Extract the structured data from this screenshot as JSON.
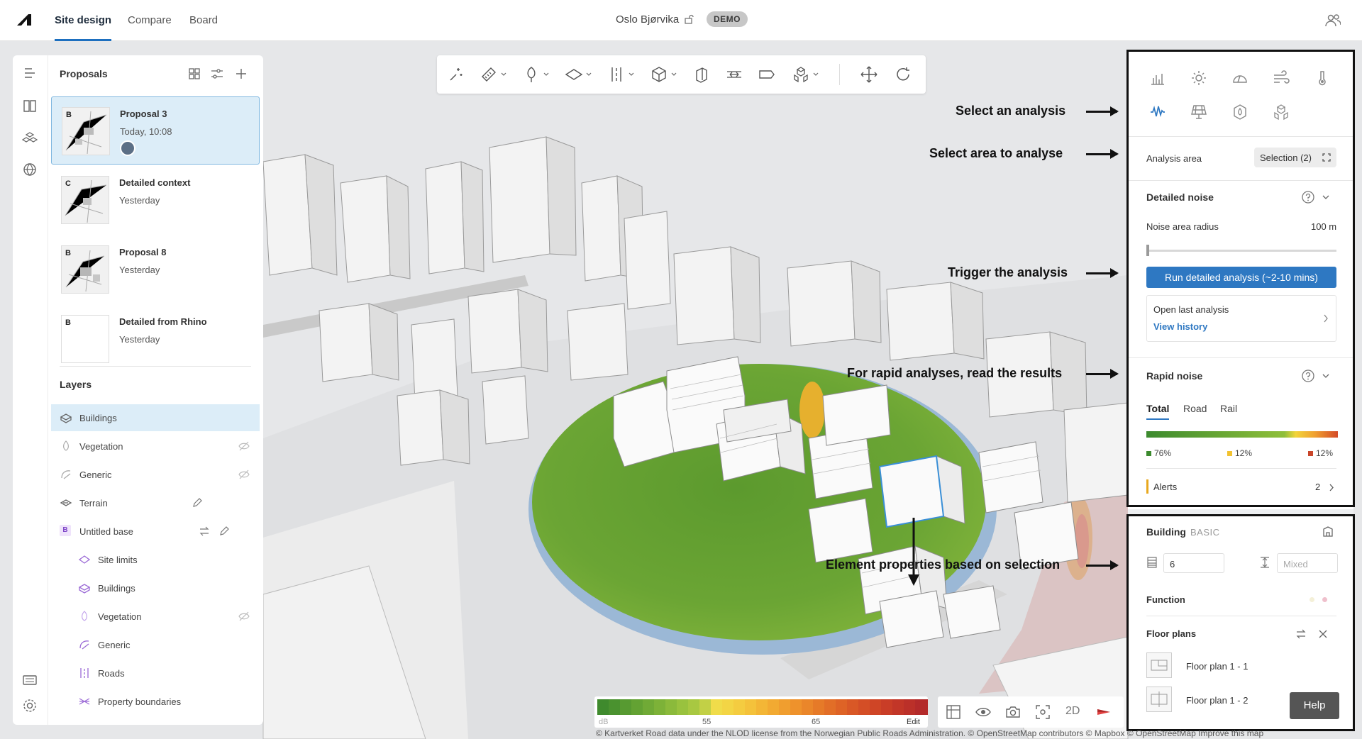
{
  "header": {
    "tabs": [
      "Site design",
      "Compare",
      "Board"
    ],
    "project_name": "Oslo Bjørvika",
    "demo_badge": "DEMO"
  },
  "proposals": {
    "title": "Proposals",
    "items": [
      {
        "letter": "B",
        "name": "Proposal 3",
        "date": "Today, 10:08"
      },
      {
        "letter": "C",
        "name": "Detailed context",
        "date": "Yesterday"
      },
      {
        "letter": "B",
        "name": "Proposal 8",
        "date": "Yesterday"
      },
      {
        "letter": "B",
        "name": "Detailed from Rhino",
        "date": "Yesterday"
      }
    ]
  },
  "layers": {
    "title": "Layers",
    "items": [
      {
        "label": "Buildings"
      },
      {
        "label": "Vegetation"
      },
      {
        "label": "Generic"
      },
      {
        "label": "Terrain"
      },
      {
        "label": "Untitled base",
        "badge": "B"
      },
      {
        "label": "Site limits"
      },
      {
        "label": "Buildings"
      },
      {
        "label": "Vegetation"
      },
      {
        "label": "Generic"
      },
      {
        "label": "Roads"
      },
      {
        "label": "Property boundaries"
      }
    ]
  },
  "analysis": {
    "area_label": "Analysis area",
    "area_value": "Selection (2)",
    "detailed_title": "Detailed noise",
    "radius_label": "Noise area radius",
    "radius_value": "100 m",
    "run_button": "Run detailed analysis (~2-10 mins)",
    "open_last": "Open last analysis",
    "view_history": "View history",
    "rapid_title": "Rapid noise",
    "rapid_tabs": [
      "Total",
      "Road",
      "Rail"
    ],
    "pct_green": "76%",
    "pct_yellow": "12%",
    "pct_red": "12%",
    "alerts_label": "Alerts",
    "alerts_count": "2"
  },
  "building": {
    "title": "Building",
    "type": "BASIC",
    "floors_value": "6",
    "height_placeholder": "Mixed",
    "function_label": "Function",
    "floor_plans_label": "Floor plans",
    "floor_plans": [
      "Floor plan 1 - 1",
      "Floor plan 1 - 2"
    ],
    "help_button": "Help"
  },
  "annotations": {
    "select_analysis": "Select an analysis",
    "select_area": "Select area to analyse",
    "trigger": "Trigger the analysis",
    "rapid": "For rapid analyses, read the results",
    "element_props": "Element properties based on selection"
  },
  "legend": {
    "unit": "dB",
    "tick_55": "55",
    "tick_65": "65",
    "edit": "Edit"
  },
  "view_controls": {
    "mode_2d": "2D"
  },
  "attribution": "© Kartverket  Road data under the NLOD license from the Norwegian Public Roads Administration.  © OpenStreetMap contributors  © Mapbox  © OpenStreetMap  Improve this map",
  "colors": {
    "accent": "#2e78c2",
    "noise_green": "#4f9a2c",
    "noise_yellow": "#f2c230",
    "noise_red": "#d9532a",
    "selected_bg": "#dcedf8"
  }
}
